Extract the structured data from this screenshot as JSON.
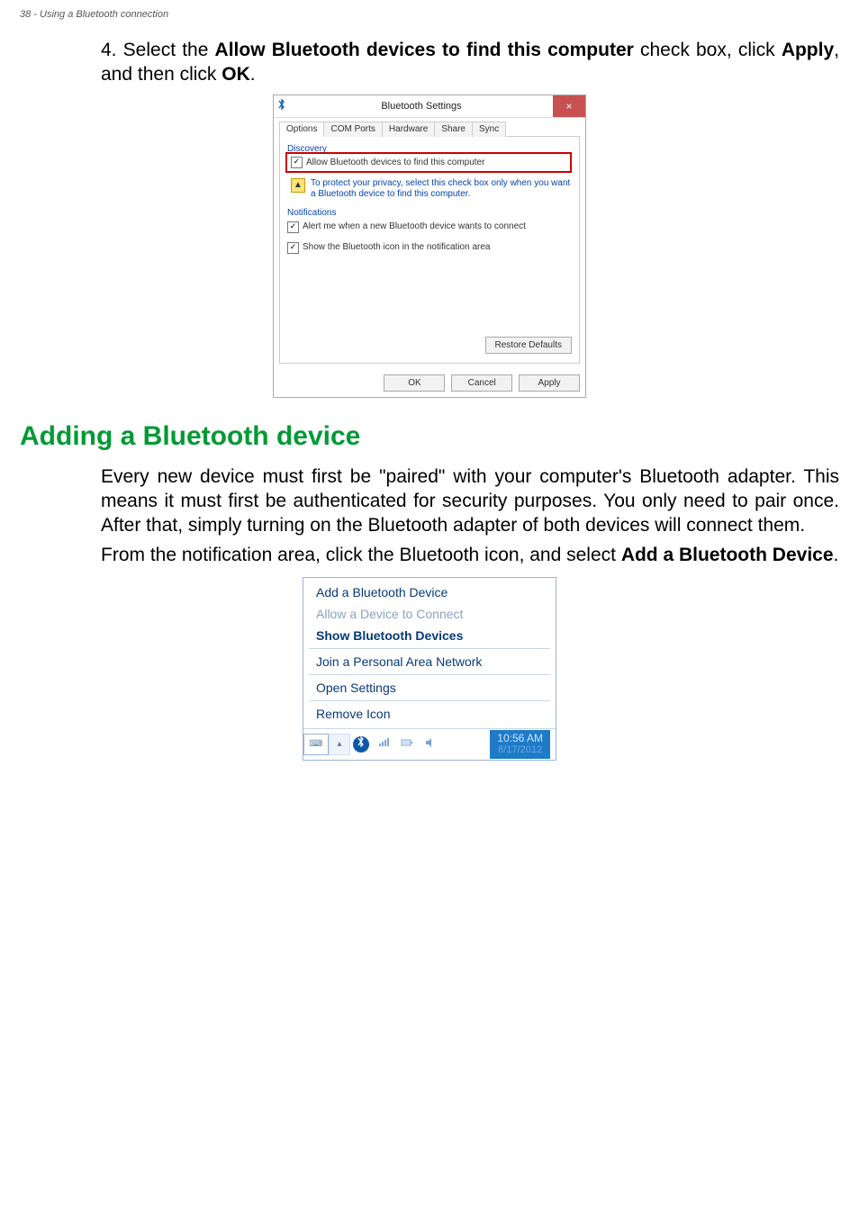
{
  "header_note": "38 - Using a Bluetooth connection",
  "step": {
    "num": "4.",
    "pre": "Select the ",
    "bold1": "Allow Bluetooth devices to find this computer",
    "mid1": " check box, click ",
    "bold2": "Apply",
    "mid2": ", and then click ",
    "bold3": "OK",
    "end": "."
  },
  "dialog": {
    "title": "Bluetooth Settings",
    "tabs": [
      "Options",
      "COM Ports",
      "Hardware",
      "Share",
      "Sync"
    ],
    "group_discovery": "Discovery",
    "cb_allow": "Allow Bluetooth devices to find this computer",
    "info": "To protect your privacy, select this check box only when you want a Bluetooth device to find this computer.",
    "group_notifications": "Notifications",
    "cb_alert": "Alert me when a new Bluetooth device wants to connect",
    "cb_showicon": "Show the Bluetooth icon in the notification area",
    "restore": "Restore Defaults",
    "ok": "OK",
    "cancel": "Cancel",
    "apply": "Apply"
  },
  "section_heading": "Adding a Bluetooth device",
  "para1": "Every new device must first be \"paired\" with your computer's Bluetooth adapter. This means it must first be authenticated for security purposes. You only need to pair once. After that, simply turning on the Bluetooth adapter of both devices will connect them.",
  "para2_pre": "From the notification area, click the Bluetooth icon, and select ",
  "para2_bold": "Add a Bluetooth Device",
  "para2_end": ".",
  "ctx": {
    "add": "Add a Bluetooth Device",
    "allow": "Allow a Device to Connect",
    "show": "Show Bluetooth Devices",
    "join": "Join a Personal Area Network",
    "open": "Open Settings",
    "remove": "Remove Icon",
    "time": "10:56 AM",
    "date": "8/17/2012"
  }
}
